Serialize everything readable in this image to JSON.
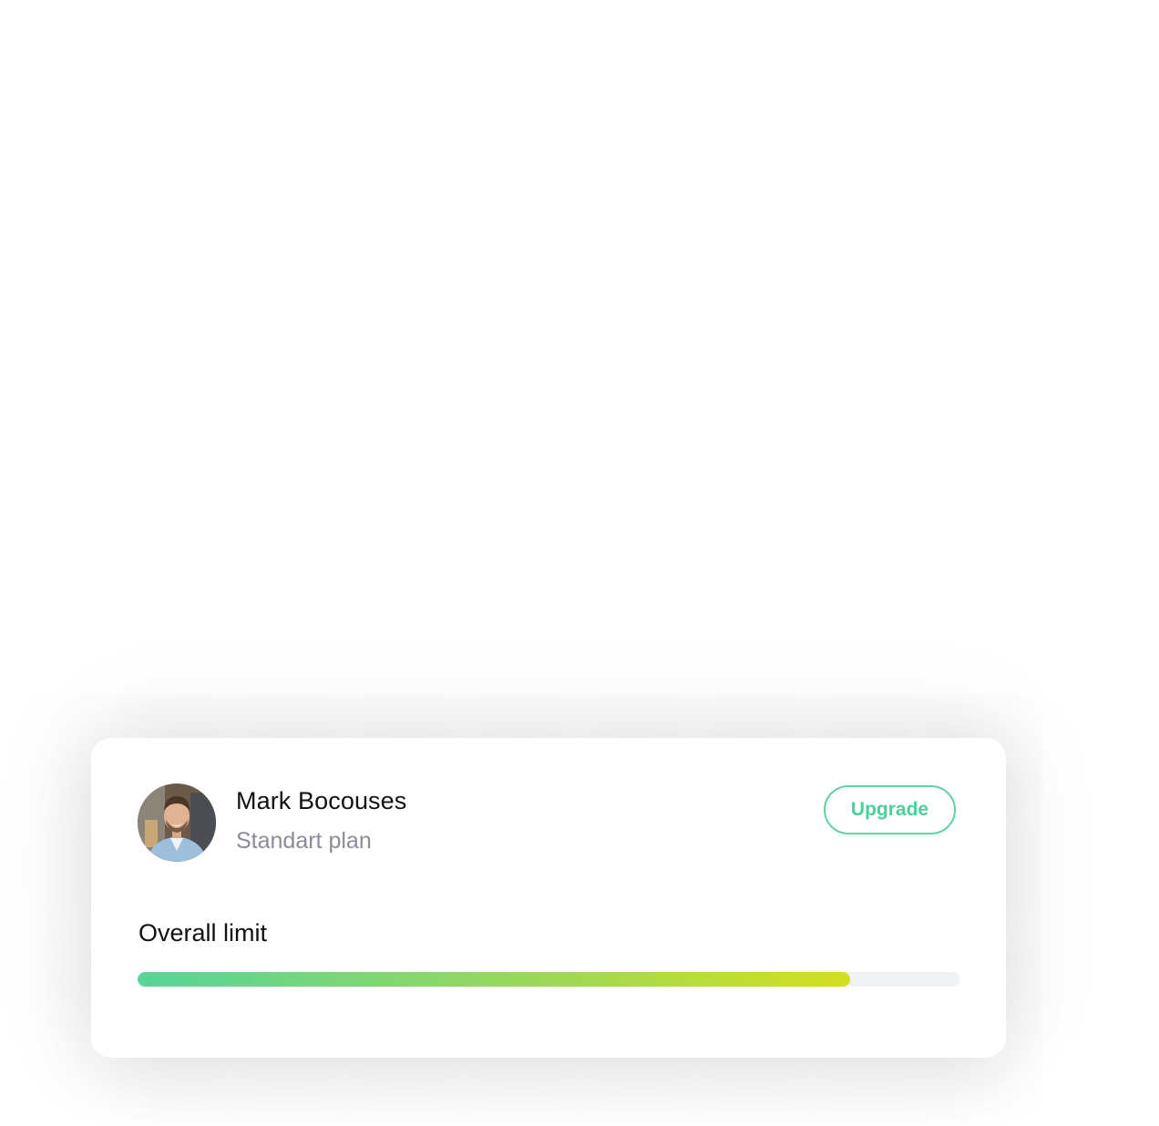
{
  "profile": {
    "name": "Mark Bocouses",
    "plan": "Standart plan",
    "avatar_icon": "user-photo-avatar"
  },
  "actions": {
    "upgrade_label": "Upgrade"
  },
  "limit": {
    "label": "Overall limit",
    "progress_fraction": 0.866
  },
  "colors": {
    "accent": "#5fd3a3",
    "progress_start": "#57d49a",
    "progress_end": "#d3df21",
    "track": "#f1f2f4",
    "secondary_text": "#8a8d96"
  }
}
